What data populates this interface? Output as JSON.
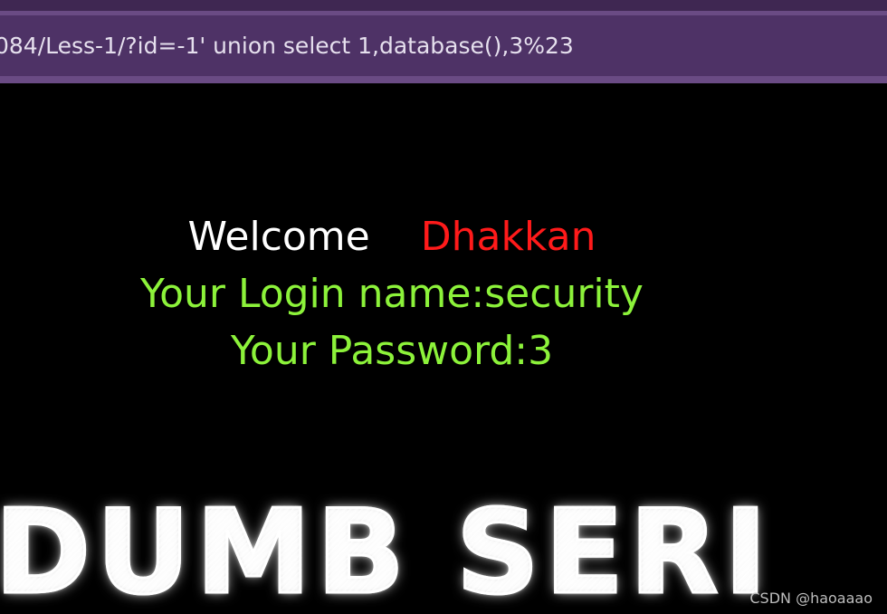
{
  "browser": {
    "url": "084/Less-1/?id=-1' union select 1,database(),3%23"
  },
  "page": {
    "welcome_label": "Welcome",
    "welcome_name": "Dhakkan",
    "login_line": "Your Login name:security",
    "password_line": "Your Password:3",
    "banner_text": "DUMB SERI",
    "watermark": "CSDN @haoaaao"
  },
  "colors": {
    "address_bar": "#4e3266",
    "background": "#000000",
    "welcome_text": "#ffffff",
    "name_text": "#ff1a1a",
    "result_text": "#8cf23a"
  }
}
